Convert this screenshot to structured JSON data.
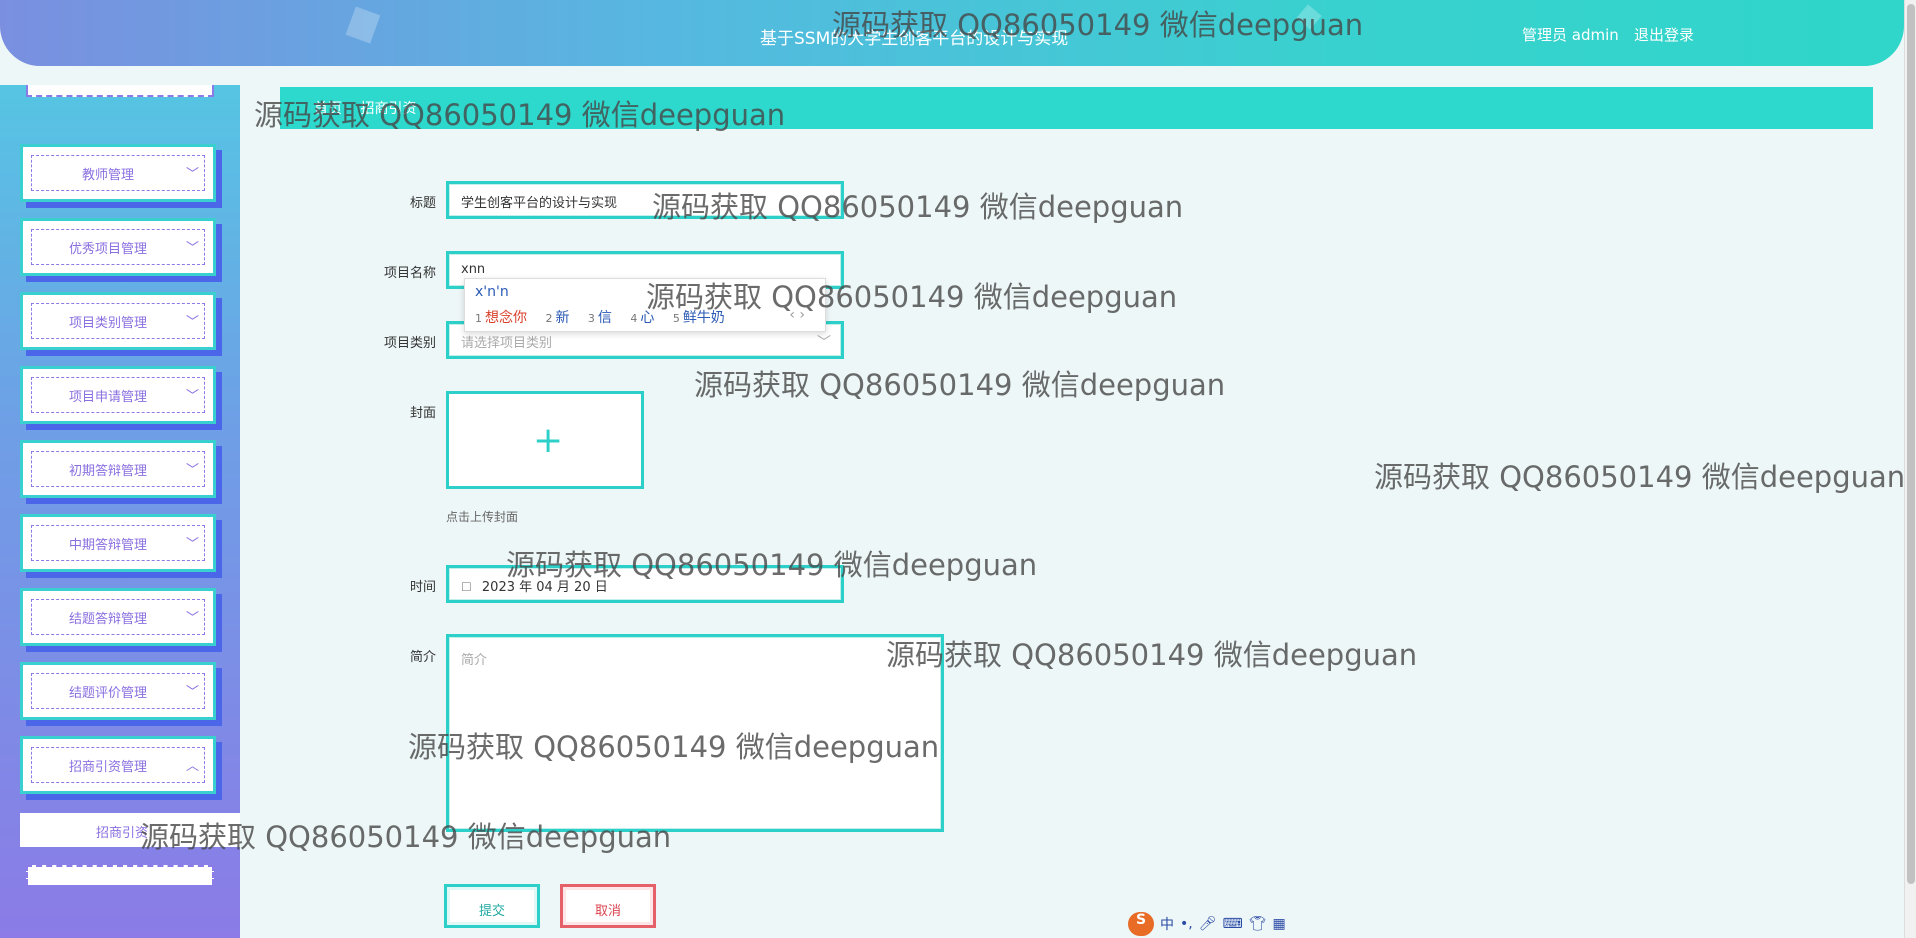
{
  "header": {
    "title": "基于SSM的大学生创客平台的设计与实现",
    "admin_label": "管理员 admin",
    "logout_label": "退出登录"
  },
  "sidebar": {
    "items": [
      {
        "label": "教师管理"
      },
      {
        "label": "优秀项目管理"
      },
      {
        "label": "项目类别管理"
      },
      {
        "label": "项目申请管理"
      },
      {
        "label": "初期答辩管理"
      },
      {
        "label": "中期答辩管理"
      },
      {
        "label": "结题答辩管理"
      },
      {
        "label": "结题评价管理"
      },
      {
        "label": "招商引资管理"
      }
    ],
    "sub_item": "招商引资"
  },
  "breadcrumb": [
    "首页",
    "招商引资"
  ],
  "form": {
    "title_label": "标题",
    "title_value": "学生创客平台的设计与实现",
    "project_name_label": "项目名称",
    "project_name_value": "xnn",
    "category_label": "项目类别",
    "category_placeholder": "请选择项目类别",
    "cover_label": "封面",
    "cover_hint": "点击上传封面",
    "time_label": "时间",
    "time_value": "2023 年 04 月 20 日",
    "intro_label": "简介",
    "intro_placeholder": "简介",
    "submit_label": "提交",
    "cancel_label": "取消"
  },
  "ime": {
    "composition": "x'n'n",
    "candidates": [
      {
        "num": "1",
        "text": "想念你"
      },
      {
        "num": "2",
        "text": "新"
      },
      {
        "num": "3",
        "text": "信"
      },
      {
        "num": "4",
        "text": "心"
      },
      {
        "num": "5",
        "text": "鲜牛奶"
      }
    ],
    "nav": "‹ ›",
    "toolbar": {
      "logo": "S",
      "mode": "中"
    }
  },
  "watermark": "源码获取 QQ86050149 微信deepguan"
}
